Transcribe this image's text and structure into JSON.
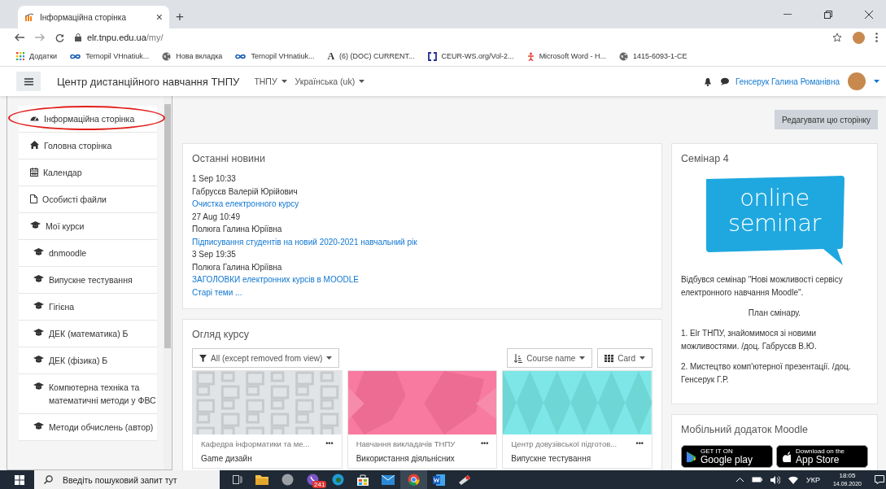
{
  "browser": {
    "tab": {
      "title": "Інформаційна сторінка",
      "close": "×"
    },
    "new_tab": "+",
    "url": {
      "host": "elr.tnpu.edu.ua",
      "path": "/my/"
    },
    "bookmarks": [
      {
        "kind": "apps",
        "label": "Додатки"
      },
      {
        "kind": "infinity",
        "label": "Ternopil VHnatiuk..."
      },
      {
        "kind": "globe",
        "label": "Нова вкладка"
      },
      {
        "kind": "infinity",
        "label": "Ternopil VHnatiuk..."
      },
      {
        "kind": "letter",
        "glyph": "A",
        "label": "(6) (DOC) CURRENT..."
      },
      {
        "kind": "bracket",
        "label": "CEUR-WS.org/Vol-2..."
      },
      {
        "kind": "figure",
        "label": "Microsoft Word - H..."
      },
      {
        "kind": "globe",
        "label": "1415-6093-1-CE"
      }
    ]
  },
  "navbar": {
    "site_name": "Центр дистанційного навчання ТНПУ",
    "menus": [
      "ТНПУ",
      "Українська (uk)"
    ],
    "user_name": "Генсерук Галина Романівна"
  },
  "sidebar": {
    "items": [
      {
        "kind": "dashboard",
        "label": "Інформаційна сторінка",
        "circled": true
      },
      {
        "kind": "home",
        "label": "Головна сторінка",
        "circled": false
      },
      {
        "kind": "calendar",
        "label": "Календар",
        "circled": false
      },
      {
        "kind": "file",
        "label": "Особисті файли",
        "circled": false
      },
      {
        "kind": "course",
        "label": "Мої курси",
        "circled": false,
        "children": [
          {
            "kind": "course",
            "label": "dnmoodle",
            "circled": false
          },
          {
            "kind": "course",
            "label": "Випускне тестування",
            "circled": false
          },
          {
            "kind": "course",
            "label": "Гігієна",
            "circled": false
          },
          {
            "kind": "course",
            "label": "ДЕК (математика) Б",
            "circled": false
          },
          {
            "kind": "course",
            "label": "ДЕК (фізика) Б",
            "circled": false
          },
          {
            "kind": "course",
            "label": "Компютерна техніка та математичні методи у ФВС",
            "circled": false
          },
          {
            "kind": "course",
            "label": "Методи обчислень (автор)",
            "circled": false
          }
        ]
      }
    ]
  },
  "edit_button": "Редагувати цю сторінку",
  "news": {
    "title": "Останні новини",
    "entries": [
      {
        "date": "1 Sep 10:33",
        "author": "Габрусєв Валерій Юрійович",
        "link": "Очистка електронного курсу"
      },
      {
        "date": "27 Aug 10:49",
        "author": "Полюга Галина Юріївна",
        "link": "Підписування студентів на новий 2020-2021 навчальний рік"
      },
      {
        "date": "3 Sep 19:35",
        "author": "Полюга Галина Юріївна",
        "link": "ЗАГОЛОВКИ електронних курсів в MOODLE"
      }
    ],
    "older": "Старі теми ..."
  },
  "overview": {
    "title": "Огляд курсу",
    "filter": "All (except removed from view)",
    "sort": "Course name",
    "view": "Card",
    "courses": [
      {
        "kind": "squares",
        "category": "Кафедра інформатики та ме...",
        "name": "Game дизайн",
        "menu": "•••"
      },
      {
        "kind": "hexagons",
        "category": "Навчання викладачів ТНПУ",
        "name": "Використання діяльнісних",
        "menu": "•••"
      },
      {
        "kind": "diamonds",
        "category": "Центр довузівської підготов...",
        "name": "Випускне тестування",
        "menu": "•••"
      }
    ]
  },
  "seminar": {
    "title": "Семінар 4",
    "banner": [
      "online",
      "seminar"
    ],
    "paragraphs": [
      {
        "centered": false,
        "text": "Відбувся семінар \"Нові можливості сервісу електронного навчання Moodle\"."
      },
      {
        "centered": true,
        "text": "План смінару."
      },
      {
        "centered": false,
        "text": "1. Elr ТНПУ, знайомимося зі новими можливостями. /доц. Габрусєв В.Ю."
      },
      {
        "centered": false,
        "text": "2. Мистецтво комп'ютерної презентації. /доц. Генсерук Г.Р."
      }
    ]
  },
  "mobile": {
    "title": "Мобільний додаток Moodle",
    "badges": [
      {
        "kind": "google",
        "small": "GET IT ON",
        "big": "Google play"
      },
      {
        "kind": "apple",
        "small": "Download on the",
        "big": "App Store"
      }
    ]
  },
  "taskbar": {
    "search_placeholder": "Введіть пошуковий запит тут",
    "badge": "241",
    "language": "УКР",
    "time": "18:05",
    "date": "14.09.2020"
  }
}
